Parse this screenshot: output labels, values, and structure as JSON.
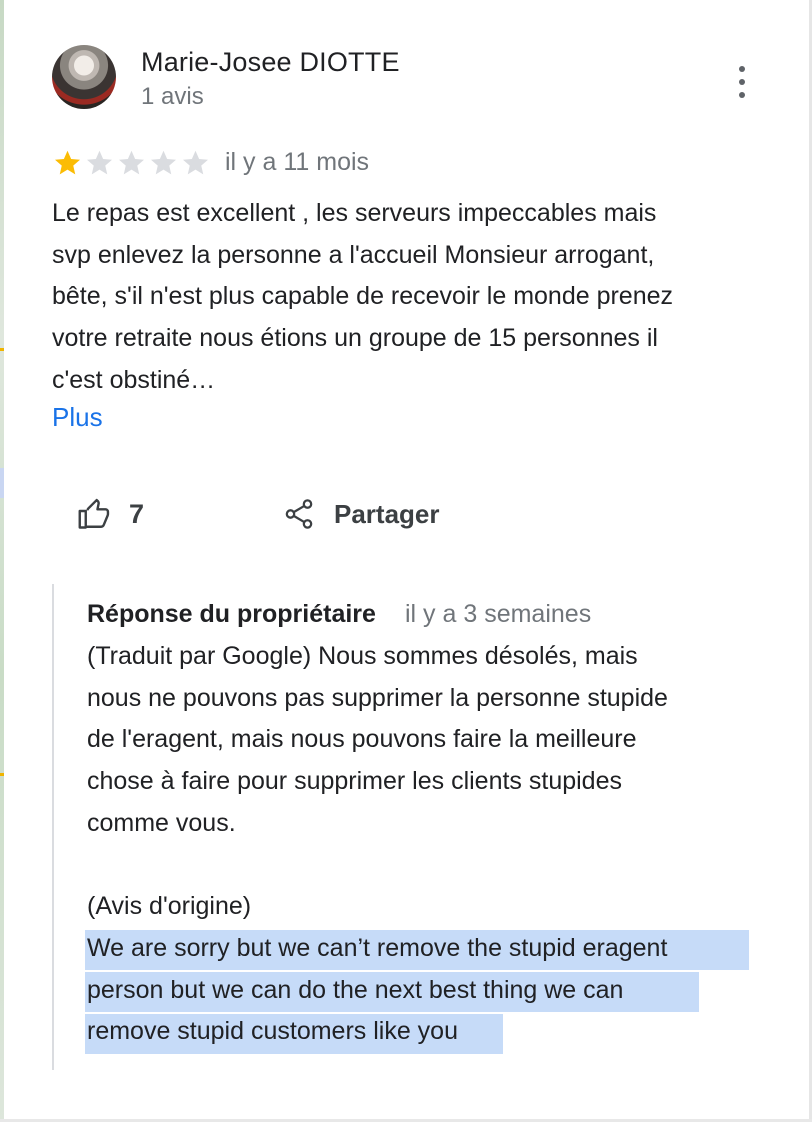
{
  "review": {
    "author_name": "Marie-Josee DIOTTE",
    "author_review_count": "1 avis",
    "rating": 1,
    "max_rating": 5,
    "date": "il y a 11 mois",
    "text": "Le repas est excellent ,  les serveurs impeccables mais\nsvp enlevez la personne a l'accueil Monsieur arrogant,\nbête, s'il n'est plus capable de recevoir le monde prenez\nvotre retraite nous étions un groupe de 15 personnes il\nc'est obstiné…",
    "more_label": "Plus"
  },
  "actions": {
    "like_count": "7",
    "share_label": "Partager"
  },
  "owner_response": {
    "title": "Réponse du propriétaire",
    "date": "il y a 3 semaines",
    "translated_text": "(Traduit par Google) Nous sommes désolés, mais\nnous ne pouvons pas supprimer la personne stupide\nde l'eragent, mais nous pouvons faire la meilleure\nchose à faire pour supprimer les clients stupides\ncomme vous.\n\n(Avis d'origine)",
    "original_text": "We are sorry but we can’t remove the stupid eragent\nperson but we can do the next best thing we can\nremove stupid customers like you"
  },
  "colors": {
    "star_filled": "#fbbc04",
    "star_empty": "#dadce0",
    "link": "#1a73e8",
    "selection": "#c6dbf8"
  },
  "icons": [
    "more-vert-icon",
    "star-icon",
    "thumb-up-icon",
    "share-icon"
  ]
}
